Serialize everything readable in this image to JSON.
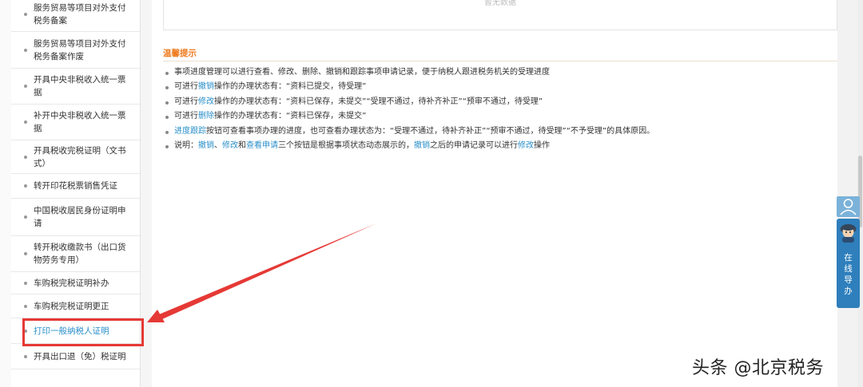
{
  "sidebar": {
    "items": [
      {
        "label": "服务贸易等项目对外支付税务备案"
      },
      {
        "label": "服务贸易等项目对外支付税务备案作废"
      },
      {
        "label": "开具中央非税收入统一票据"
      },
      {
        "label": "补开中央非税收入统一票据"
      },
      {
        "label": "开具税收完税证明（文书式）"
      },
      {
        "label": "转开印花税票销售凭证"
      },
      {
        "label": "中国税收居民身份证明申请"
      },
      {
        "label": "转开税收缴款书（出口货物劳务专用）"
      },
      {
        "label": "车购税完税证明补办"
      },
      {
        "label": "车购税完税证明更正"
      },
      {
        "label": "打印一般纳税人证明"
      },
      {
        "label": "开具出口退（免）税证明"
      }
    ],
    "active_index": 10
  },
  "main": {
    "no_data": "暂无数据",
    "tips_title": "温馨提示",
    "tips": {
      "l1": "事项进度管理可以进行查看、修改、删除、撤销和跟踪事项申请记录，便于纳税人跟进税务机关的受理进度",
      "l2_pre": "可进行",
      "l2_link": "撤销",
      "l2_post": "操作的办理状态有：“资料已提交，待受理”",
      "l3_pre": "可进行",
      "l3_link": "修改",
      "l3_post": "操作的办理状态有：“资料已保存，未提交”“受理不通过，待补齐补正”“预审不通过，待受理”",
      "l4_pre": "可进行",
      "l4_link": "删除",
      "l4_post": "操作的办理状态有：“资料已保存，未提交”",
      "l5_link": "进度跟踪",
      "l5_post": "按钮可查看事项办理的进度，也可查看办理状态为：“受理不通过，待补齐补正”“预审不通过，待受理”“不予受理”的具体原因。",
      "l6_pre": "说明：",
      "l6_link1": "撤销",
      "l6_sep1": "、",
      "l6_link2": "修改",
      "l6_mid": "和",
      "l6_link3": "查看申请",
      "l6_mid2": "三个按钮是根据事项状态动态展示的，",
      "l6_link4": "撤销",
      "l6_mid3": "之后的申请记录可以进行",
      "l6_link5": "修改",
      "l6_end": "操作"
    }
  },
  "online_guide": {
    "chars": [
      "在",
      "线",
      "导",
      "办"
    ]
  },
  "watermark": "头条 @北京税务",
  "colors": {
    "accent": "#2a8fc9",
    "tips_title": "#ef7a1d",
    "highlight": "#e53935"
  },
  "icons": [
    "user-icon",
    "service-avatar-icon",
    "annotation-arrow"
  ]
}
